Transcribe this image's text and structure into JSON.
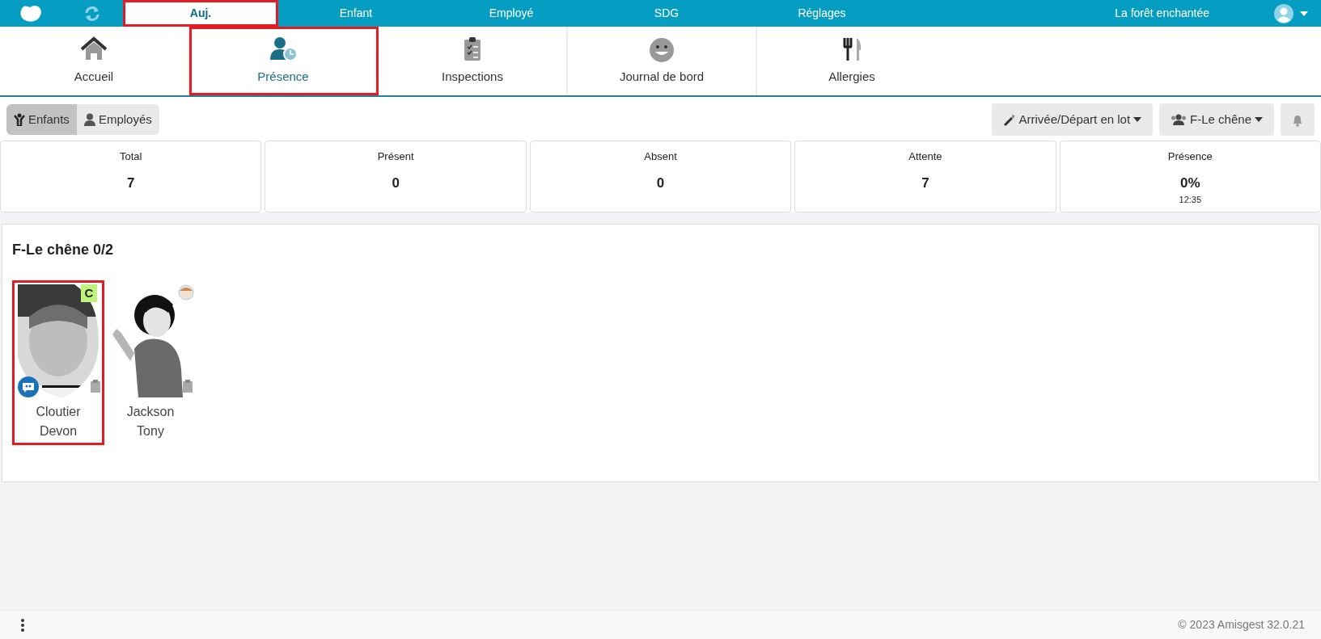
{
  "topbar": {
    "items": [
      {
        "label": "Auj.",
        "selected": true,
        "highlighted": true
      },
      {
        "label": "Enfant",
        "selected": false,
        "highlighted": false
      },
      {
        "label": "Employé",
        "selected": false,
        "highlighted": false
      },
      {
        "label": "SDG",
        "selected": false,
        "highlighted": false
      },
      {
        "label": "Réglages",
        "selected": false,
        "highlighted": false
      }
    ],
    "center_name": "La forêt enchantée"
  },
  "modules": [
    {
      "kind": "home",
      "label": "Accueil",
      "selected": false,
      "highlighted": false
    },
    {
      "kind": "presence",
      "label": "Présence",
      "selected": true,
      "highlighted": true
    },
    {
      "kind": "inspections",
      "label": "Inspections",
      "selected": false,
      "highlighted": false
    },
    {
      "kind": "journal",
      "label": "Journal de bord",
      "selected": false,
      "highlighted": false
    },
    {
      "kind": "allergies",
      "label": "Allergies",
      "selected": false,
      "highlighted": false
    }
  ],
  "toggle": [
    {
      "kind": "child",
      "label": "Enfants",
      "selected": true
    },
    {
      "kind": "employee",
      "label": "Employés",
      "selected": false
    }
  ],
  "actions": {
    "batch": "Arrivée/Départ en lot",
    "group": "F-Le chêne"
  },
  "stats": [
    {
      "label": "Total",
      "value": "7"
    },
    {
      "label": "Présent",
      "value": "0"
    },
    {
      "label": "Absent",
      "value": "0"
    },
    {
      "label": "Attente",
      "value": "7"
    },
    {
      "label": "Présence",
      "value": "0%",
      "time": "12:35"
    }
  ],
  "group": {
    "title": "F-Le chêne 0/2",
    "children": [
      {
        "last_name": "Cloutier",
        "first_name": "Devon",
        "badge": "C",
        "has_message": true,
        "has_mini_avatar": false,
        "highlighted": true
      },
      {
        "last_name": "Jackson",
        "first_name": "Tony",
        "kind": "cartoon",
        "has_message": false,
        "has_mini_avatar": true,
        "highlighted": false
      }
    ]
  },
  "footer": {
    "copyright": "© 2023 Amisgest 32.0.21"
  }
}
